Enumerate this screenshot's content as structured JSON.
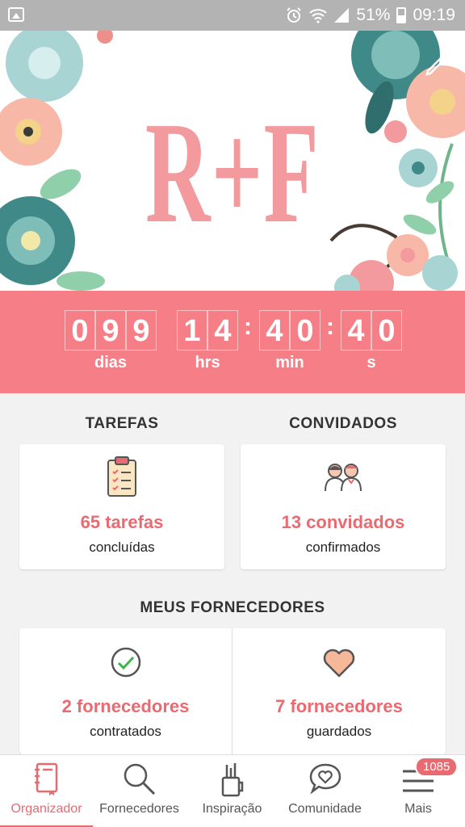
{
  "status_bar": {
    "battery_percent": "51%",
    "time": "09:19"
  },
  "header": {
    "monogram": "R+F"
  },
  "countdown": {
    "days_digits": [
      "0",
      "9",
      "9"
    ],
    "hours_digits": [
      "1",
      "4"
    ],
    "minutes_digits": [
      "4",
      "0"
    ],
    "seconds_digits": [
      "4",
      "0"
    ],
    "labels": {
      "days": "dias",
      "hours": "hrs",
      "minutes": "min",
      "seconds": "s"
    },
    "color": "#f67e86"
  },
  "tasks": {
    "title": "TAREFAS",
    "value": "65 tarefas",
    "subtitle": "concluídas",
    "icon": "clipboard-checklist-icon"
  },
  "guests": {
    "title": "CONVIDADOS",
    "value": "13 convidados",
    "subtitle": "confirmados",
    "icon": "couple-icon"
  },
  "vendors": {
    "title": "MEUS FORNECEDORES",
    "hired": {
      "value": "2 fornecedores",
      "subtitle": "contratados",
      "icon": "check-circle-icon"
    },
    "saved": {
      "value": "7 fornecedores",
      "subtitle": "guardados",
      "icon": "heart-icon"
    }
  },
  "bottom_nav": {
    "items": [
      {
        "label": "Organizador",
        "icon": "notebook-icon",
        "active": true
      },
      {
        "label": "Fornecedores",
        "icon": "search-icon",
        "active": false
      },
      {
        "label": "Inspiração",
        "icon": "pencil-cup-icon",
        "active": false
      },
      {
        "label": "Comunidade",
        "icon": "chat-heart-icon",
        "active": false
      },
      {
        "label": "Mais",
        "icon": "menu-icon",
        "active": false
      }
    ],
    "badge": "1085"
  },
  "accent_color": "#e96a70"
}
